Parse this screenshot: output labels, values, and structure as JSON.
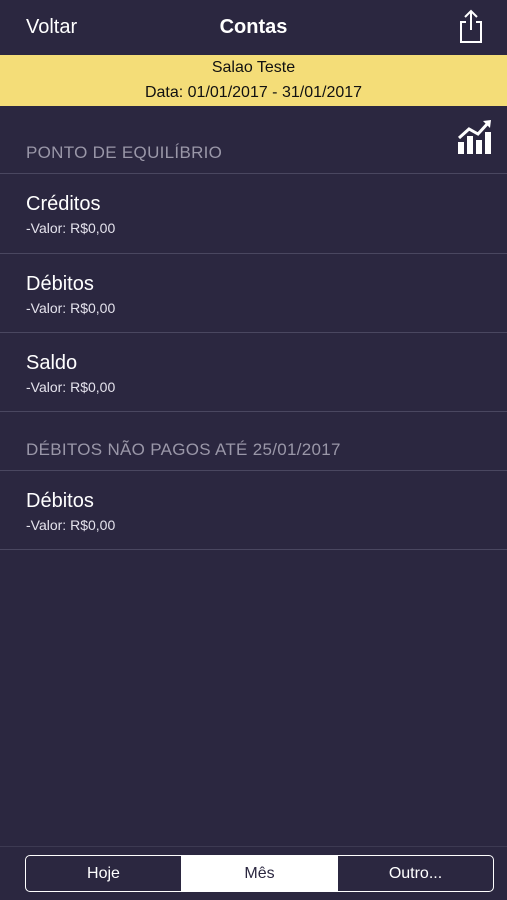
{
  "nav": {
    "back_label": "Voltar",
    "title": "Contas",
    "share_icon": "share-icon"
  },
  "banner": {
    "name": "Salao Teste",
    "period": "Data: 01/01/2017 - 31/01/2017",
    "background": "#f4dd78"
  },
  "chart_icon": "chart-trend-icon",
  "sections": [
    {
      "header": "PONTO DE EQUILÍBRIO",
      "rows": [
        {
          "title": "Créditos",
          "subtitle": "-Valor: R$0,00"
        },
        {
          "title": "Débitos",
          "subtitle": "-Valor: R$0,00"
        },
        {
          "title": "Saldo",
          "subtitle": "-Valor: R$0,00"
        }
      ]
    },
    {
      "header": "DÉBITOS NÃO PAGOS ATÉ 25/01/2017",
      "rows": [
        {
          "title": "Débitos",
          "subtitle": "-Valor: R$0,00"
        }
      ]
    }
  ],
  "segments": {
    "items": [
      "Hoje",
      "Mês",
      "Outro..."
    ],
    "selected": "Mês"
  },
  "colors": {
    "background": "#2b2740",
    "text": "#ffffff",
    "header_text": "#9a97a8"
  }
}
